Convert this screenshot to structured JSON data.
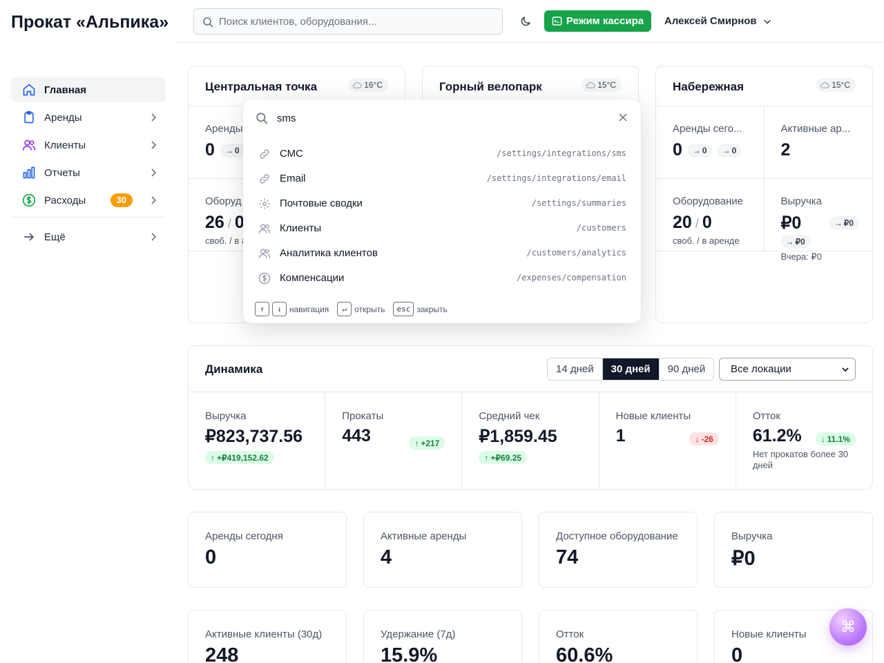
{
  "app": {
    "title": "Прокат «Альпика»"
  },
  "sidebar": {
    "items": [
      {
        "label": "Главная",
        "icon": "home-icon"
      },
      {
        "label": "Аренды",
        "icon": "clipboard-icon"
      },
      {
        "label": "Клиенты",
        "icon": "users-icon"
      },
      {
        "label": "Отчеты",
        "icon": "bar-chart-icon"
      },
      {
        "label": "Расходы",
        "icon": "dollar-circle-icon",
        "badge": "30"
      }
    ],
    "more_label": "Ещё"
  },
  "topbar": {
    "search_placeholder": "Поиск клиентов, оборудования...",
    "cashier_label": "Режим кассира",
    "user_name": "Алексей Смирнов"
  },
  "locations": [
    {
      "name": "Центральная точка",
      "weather": "16°C",
      "rentals_today_label": "Аренды",
      "rentals_today": "0",
      "delta1": "0",
      "equipment_label": "Оборуд",
      "equip_free": "26",
      "equip_rented": "0",
      "equip_sub": "своб. / в а"
    },
    {
      "name": "Горный велопарк",
      "weather": "15°C"
    },
    {
      "name": "Набережная",
      "weather": "15°C",
      "rentals_today_label": "Аренды сего...",
      "rentals_today": "0",
      "delta1": "0",
      "delta2": "0",
      "active_label": "Активные ар...",
      "active": "2",
      "equipment_label": "Оборудование",
      "equip_free": "20",
      "equip_rented": "0",
      "equip_sub": "своб. / в аренде",
      "revenue_label": "Выручка",
      "revenue": "₽0",
      "rev_delta1": "₽0",
      "rev_delta2": "₽0",
      "yesterday": "Вчера: ₽0"
    }
  ],
  "dynamics": {
    "title": "Динамика",
    "ranges": [
      "14 дней",
      "30 дней",
      "90 дней"
    ],
    "active_range": "30 дней",
    "location_select": "Все локации",
    "metrics": [
      {
        "label": "Выручка",
        "value": "₽823,737.56",
        "delta": "+₽419,152.62"
      },
      {
        "label": "Прокаты",
        "value": "443",
        "delta": "+217"
      },
      {
        "label": "Средний чек",
        "value": "₽1,859.45",
        "delta": "+₽69.25"
      },
      {
        "label": "Новые клиенты",
        "value": "1",
        "delta": "-26"
      },
      {
        "label": "Отток",
        "value": "61.2%",
        "delta": "11.1%",
        "note": "Нет прокатов более 30 дней"
      }
    ]
  },
  "stats_row1": [
    {
      "label": "Аренды сегодня",
      "value": "0"
    },
    {
      "label": "Активные аренды",
      "value": "4"
    },
    {
      "label": "Доступное оборудование",
      "value": "74"
    },
    {
      "label": "Выручка",
      "value": "₽0"
    }
  ],
  "stats_row2": [
    {
      "label": "Активные клиенты (30д)",
      "value": "248"
    },
    {
      "label": "Удержание (7д)",
      "value": "15.9%"
    },
    {
      "label": "Отток",
      "value": "60.6%"
    },
    {
      "label": "Новые клиенты",
      "value": "0"
    }
  ],
  "palette": {
    "query": "sms",
    "results": [
      {
        "label": "СМС",
        "path": "/settings/integrations/sms",
        "icon": "link-icon"
      },
      {
        "label": "Email",
        "path": "/settings/integrations/email",
        "icon": "link-icon"
      },
      {
        "label": "Почтовые сводки",
        "path": "/settings/summaries",
        "icon": "gear-icon"
      },
      {
        "label": "Клиенты",
        "path": "/customers",
        "icon": "users-icon"
      },
      {
        "label": "Аналитика клиентов",
        "path": "/customers/analytics",
        "icon": "users-icon"
      },
      {
        "label": "Компенсации",
        "path": "/expenses/compensation",
        "icon": "dollar-circle-icon"
      }
    ],
    "footer": {
      "up_key": "↑",
      "down_key": "↓",
      "nav_label": "навигация",
      "enter_key": "↵",
      "open_label": "открыть",
      "esc_key": "esc",
      "close_label": "закрыть"
    }
  },
  "fab": {
    "symbol": "⌘"
  },
  "colors": {
    "accent_green": "#16a34a",
    "badge_orange": "#f59e0b",
    "fab_purple": "#a855f7"
  }
}
